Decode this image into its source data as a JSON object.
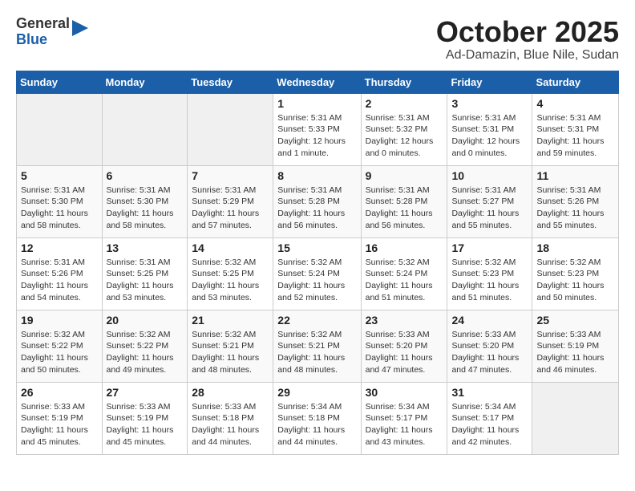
{
  "header": {
    "logo_general": "General",
    "logo_blue": "Blue",
    "month_title": "October 2025",
    "subtitle": "Ad-Damazin, Blue Nile, Sudan"
  },
  "days_of_week": [
    "Sunday",
    "Monday",
    "Tuesday",
    "Wednesday",
    "Thursday",
    "Friday",
    "Saturday"
  ],
  "weeks": [
    [
      {
        "day": "",
        "info": ""
      },
      {
        "day": "",
        "info": ""
      },
      {
        "day": "",
        "info": ""
      },
      {
        "day": "1",
        "info": "Sunrise: 5:31 AM\nSunset: 5:33 PM\nDaylight: 12 hours\nand 1 minute."
      },
      {
        "day": "2",
        "info": "Sunrise: 5:31 AM\nSunset: 5:32 PM\nDaylight: 12 hours\nand 0 minutes."
      },
      {
        "day": "3",
        "info": "Sunrise: 5:31 AM\nSunset: 5:31 PM\nDaylight: 12 hours\nand 0 minutes."
      },
      {
        "day": "4",
        "info": "Sunrise: 5:31 AM\nSunset: 5:31 PM\nDaylight: 11 hours\nand 59 minutes."
      }
    ],
    [
      {
        "day": "5",
        "info": "Sunrise: 5:31 AM\nSunset: 5:30 PM\nDaylight: 11 hours\nand 58 minutes."
      },
      {
        "day": "6",
        "info": "Sunrise: 5:31 AM\nSunset: 5:30 PM\nDaylight: 11 hours\nand 58 minutes."
      },
      {
        "day": "7",
        "info": "Sunrise: 5:31 AM\nSunset: 5:29 PM\nDaylight: 11 hours\nand 57 minutes."
      },
      {
        "day": "8",
        "info": "Sunrise: 5:31 AM\nSunset: 5:28 PM\nDaylight: 11 hours\nand 56 minutes."
      },
      {
        "day": "9",
        "info": "Sunrise: 5:31 AM\nSunset: 5:28 PM\nDaylight: 11 hours\nand 56 minutes."
      },
      {
        "day": "10",
        "info": "Sunrise: 5:31 AM\nSunset: 5:27 PM\nDaylight: 11 hours\nand 55 minutes."
      },
      {
        "day": "11",
        "info": "Sunrise: 5:31 AM\nSunset: 5:26 PM\nDaylight: 11 hours\nand 55 minutes."
      }
    ],
    [
      {
        "day": "12",
        "info": "Sunrise: 5:31 AM\nSunset: 5:26 PM\nDaylight: 11 hours\nand 54 minutes."
      },
      {
        "day": "13",
        "info": "Sunrise: 5:31 AM\nSunset: 5:25 PM\nDaylight: 11 hours\nand 53 minutes."
      },
      {
        "day": "14",
        "info": "Sunrise: 5:32 AM\nSunset: 5:25 PM\nDaylight: 11 hours\nand 53 minutes."
      },
      {
        "day": "15",
        "info": "Sunrise: 5:32 AM\nSunset: 5:24 PM\nDaylight: 11 hours\nand 52 minutes."
      },
      {
        "day": "16",
        "info": "Sunrise: 5:32 AM\nSunset: 5:24 PM\nDaylight: 11 hours\nand 51 minutes."
      },
      {
        "day": "17",
        "info": "Sunrise: 5:32 AM\nSunset: 5:23 PM\nDaylight: 11 hours\nand 51 minutes."
      },
      {
        "day": "18",
        "info": "Sunrise: 5:32 AM\nSunset: 5:23 PM\nDaylight: 11 hours\nand 50 minutes."
      }
    ],
    [
      {
        "day": "19",
        "info": "Sunrise: 5:32 AM\nSunset: 5:22 PM\nDaylight: 11 hours\nand 50 minutes."
      },
      {
        "day": "20",
        "info": "Sunrise: 5:32 AM\nSunset: 5:22 PM\nDaylight: 11 hours\nand 49 minutes."
      },
      {
        "day": "21",
        "info": "Sunrise: 5:32 AM\nSunset: 5:21 PM\nDaylight: 11 hours\nand 48 minutes."
      },
      {
        "day": "22",
        "info": "Sunrise: 5:32 AM\nSunset: 5:21 PM\nDaylight: 11 hours\nand 48 minutes."
      },
      {
        "day": "23",
        "info": "Sunrise: 5:33 AM\nSunset: 5:20 PM\nDaylight: 11 hours\nand 47 minutes."
      },
      {
        "day": "24",
        "info": "Sunrise: 5:33 AM\nSunset: 5:20 PM\nDaylight: 11 hours\nand 47 minutes."
      },
      {
        "day": "25",
        "info": "Sunrise: 5:33 AM\nSunset: 5:19 PM\nDaylight: 11 hours\nand 46 minutes."
      }
    ],
    [
      {
        "day": "26",
        "info": "Sunrise: 5:33 AM\nSunset: 5:19 PM\nDaylight: 11 hours\nand 45 minutes."
      },
      {
        "day": "27",
        "info": "Sunrise: 5:33 AM\nSunset: 5:19 PM\nDaylight: 11 hours\nand 45 minutes."
      },
      {
        "day": "28",
        "info": "Sunrise: 5:33 AM\nSunset: 5:18 PM\nDaylight: 11 hours\nand 44 minutes."
      },
      {
        "day": "29",
        "info": "Sunrise: 5:34 AM\nSunset: 5:18 PM\nDaylight: 11 hours\nand 44 minutes."
      },
      {
        "day": "30",
        "info": "Sunrise: 5:34 AM\nSunset: 5:17 PM\nDaylight: 11 hours\nand 43 minutes."
      },
      {
        "day": "31",
        "info": "Sunrise: 5:34 AM\nSunset: 5:17 PM\nDaylight: 11 hours\nand 42 minutes."
      },
      {
        "day": "",
        "info": ""
      }
    ]
  ]
}
